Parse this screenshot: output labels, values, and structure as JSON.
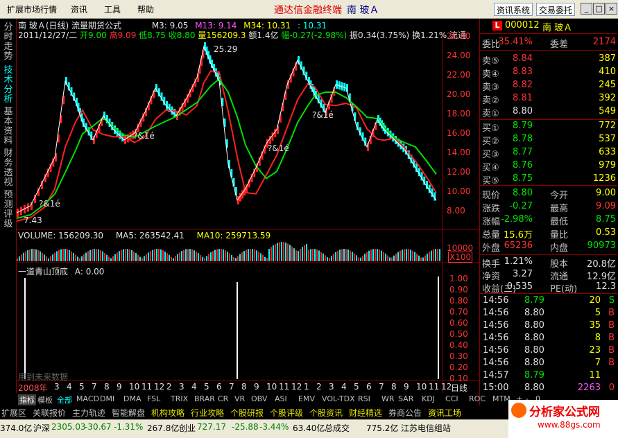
{
  "menu": {
    "market": "扩展市场行情",
    "info": "资讯",
    "tools": "工具",
    "help": "帮助"
  },
  "app_title": "通达信金融终端",
  "security_title": "南  玻Ａ",
  "top_buttons": {
    "info_system": "资讯系统",
    "trade": "交易委托"
  },
  "window_controls": [
    "_",
    "□",
    "×"
  ],
  "left_tabs": [
    {
      "label": "分时走势"
    },
    {
      "label": "技术分析"
    },
    {
      "label": "基本资料"
    },
    {
      "label": "财务透视"
    },
    {
      "label": "预测评级"
    }
  ],
  "chart_header": {
    "line1": "南  玻Ａ(日线) 流量期货公式",
    "ma3": "M3: 9.05",
    "ma13": "M13: 9.14",
    "ma34": "M34: 10.31",
    "extra": ": 10.31",
    "line2_date": "2011/12/27/二",
    "open": "开9.00",
    "high": "高9.09",
    "low": "低8.75",
    "close": "收8.80",
    "vol": "量156209.3",
    "amt": "额1.4亿",
    "pct": "幅-0.27(-2.98%)",
    "amp": "振0.34(3.75%)",
    "turn": "换1.21%",
    "flow": "流通"
  },
  "annotations": {
    "peak": "25.29",
    "low": "7.43",
    "signals": [
      "?&1é",
      "?&1é",
      "?&1é",
      "?&1é"
    ]
  },
  "price_axis": [
    "26.00",
    "24.00",
    "22.00",
    "20.00",
    "18.00",
    "16.00",
    "14.00",
    "12.00",
    "10.00",
    "8.00"
  ],
  "volume_header": {
    "label": "VOLUME: 156209.30",
    "ma5": "MA5: 263542.41",
    "ma10": "MA10: 259713.59"
  },
  "volume_axis": {
    "top": "10000",
    "unit": "X100"
  },
  "indicator_header": {
    "label": "一道青山顶底",
    "value": "A: 0.00"
  },
  "indicator_axis": [
    "1.00",
    "0.90",
    "0.80",
    "0.70",
    "0.60",
    "0.50",
    "0.40",
    "0.30",
    "0.20",
    "0.10"
  ],
  "future_data_text": "用到未来数据",
  "x_axis": {
    "labels": [
      "2008年",
      "3",
      "4",
      "5",
      "7",
      "8",
      "9",
      "10",
      "11",
      "12",
      "2",
      "3",
      "4",
      "5",
      "6",
      "7",
      "8",
      "9",
      "10",
      "11",
      "12",
      "1",
      "2",
      "3",
      "4",
      "5",
      "6",
      "7",
      "8",
      "9",
      "10",
      "11",
      "12"
    ],
    "period": "日线"
  },
  "stock_panel": {
    "code": "000012",
    "name": "南  玻Ａ",
    "wb_label": "委比",
    "wb_value": "35.41%",
    "wc_label": "委差",
    "wc_value": "2174"
  },
  "asks": [
    {
      "label": "卖⑤",
      "price": "8.84",
      "vol": "387"
    },
    {
      "label": "卖④",
      "price": "8.83",
      "vol": "410"
    },
    {
      "label": "卖③",
      "price": "8.82",
      "vol": "245"
    },
    {
      "label": "卖②",
      "price": "8.81",
      "vol": "392"
    },
    {
      "label": "卖①",
      "price": "8.80",
      "vol": "549"
    }
  ],
  "bids": [
    {
      "label": "买①",
      "price": "8.79",
      "vol": "772"
    },
    {
      "label": "买②",
      "price": "8.78",
      "vol": "537"
    },
    {
      "label": "买③",
      "price": "8.77",
      "vol": "633"
    },
    {
      "label": "买④",
      "price": "8.76",
      "vol": "979"
    },
    {
      "label": "买⑤",
      "price": "8.75",
      "vol": "1236"
    }
  ],
  "quote": [
    {
      "l1": "现价",
      "v1": "8.80",
      "c1": "g",
      "l2": "今开",
      "v2": "9.00",
      "c2": "y"
    },
    {
      "l1": "涨跌",
      "v1": "-0.27",
      "c1": "g",
      "l2": "最高",
      "v2": "9.09",
      "c2": "r"
    },
    {
      "l1": "涨幅",
      "v1": "-2.98%",
      "c1": "g",
      "l2": "最低",
      "v2": "8.75",
      "c2": "g"
    },
    {
      "l1": "总量",
      "v1": "15.6万",
      "c1": "y",
      "l2": "量比",
      "v2": "0.53",
      "c2": "y"
    },
    {
      "l1": "外盘",
      "v1": "65236",
      "c1": "r",
      "l2": "内盘",
      "v2": "90973",
      "c2": "g"
    }
  ],
  "fund": [
    {
      "l1": "换手",
      "v1": "1.21%",
      "l2": "股本",
      "v2": "20.8亿"
    },
    {
      "l1": "净资",
      "v1": "3.27",
      "l2": "流通",
      "v2": "12.9亿"
    },
    {
      "l1": "收益(三)",
      "v1": "0.535",
      "l2": "PE(动)",
      "v2": "12.3"
    }
  ],
  "ticks": [
    {
      "time": "14:56",
      "price": "8.79",
      "vol": "20",
      "dir": "S"
    },
    {
      "time": "14:56",
      "price": "8.80",
      "vol": "5",
      "dir": "B"
    },
    {
      "time": "14:56",
      "price": "8.80",
      "vol": "35",
      "dir": "B"
    },
    {
      "time": "14:56",
      "price": "8.80",
      "vol": "8",
      "dir": "B"
    },
    {
      "time": "14:56",
      "price": "8.80",
      "vol": "23",
      "dir": "B"
    },
    {
      "time": "14:56",
      "price": "8.80",
      "vol": "7",
      "dir": "B"
    },
    {
      "time": "14:57",
      "price": "8.79",
      "vol": "11",
      "dir": ""
    },
    {
      "time": "15:00",
      "price": "8.80",
      "vol": "2263",
      "dir": "0"
    }
  ],
  "indicator_tabs": [
    "指标",
    "模板",
    "全部",
    "MACD",
    "DMI",
    "DMA",
    "FSL",
    "TRIX",
    "BRAR",
    "CR",
    "VR",
    "OBV",
    "ASI",
    "EMV",
    "VOL-TDX",
    "RSI",
    "WR",
    "SAR",
    "KDJ",
    "CCI",
    "ROC",
    "MTM",
    "+",
    "-",
    "0"
  ],
  "nav_tabs": [
    "扩展区",
    "关联报价",
    "主力轨迹",
    "智能解盘",
    "机构攻略",
    "行业攻略",
    "个股研报",
    "个股评级",
    "个股资讯",
    "财经精选",
    "券商公告",
    "资讯工场"
  ],
  "status": {
    "sh": "374.0亿",
    "sz_label": "沪深",
    "sz_index": "2305.03",
    "sz_chg": "-30.67",
    "sz_pct": "-1.31%",
    "sz_amt": "267.8亿",
    "cy_label": "创业",
    "cy_index": "727.17",
    "cy_chg": "-25.88",
    "cy_pct": "-3.44%",
    "cy_amt": "63.40亿",
    "total_label": "总成交",
    "total": "775.2亿",
    "broker": "江苏电信组站"
  },
  "watermark": {
    "title": "分析家公式网",
    "url": "www.88gs.com"
  }
}
